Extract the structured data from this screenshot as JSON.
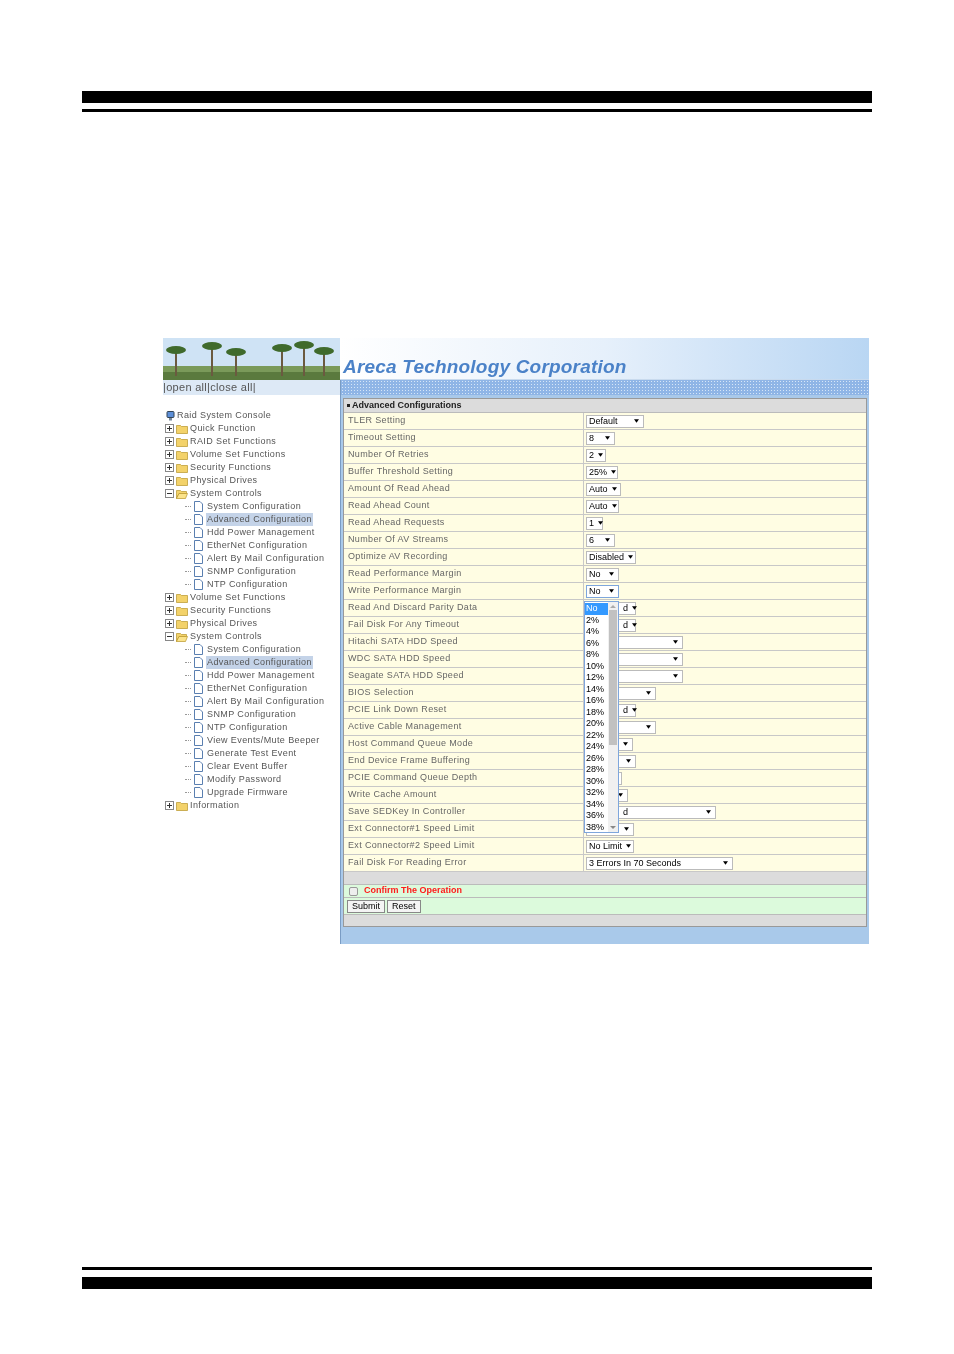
{
  "header": {
    "title": "Areca Technology Corporation"
  },
  "sidebar": {
    "toggle": "|open all|close all|",
    "tree": {
      "label": "Raid System Console",
      "children": [
        {
          "label": "Quick Function",
          "expanded": false
        },
        {
          "label": "RAID Set Functions",
          "expanded": false
        },
        {
          "label": "Volume Set Functions",
          "expanded": false
        },
        {
          "label": "Security Functions",
          "expanded": false
        },
        {
          "label": "Physical Drives",
          "expanded": false
        },
        {
          "label": "System Controls",
          "expanded": true,
          "children": [
            {
              "label": "System Configuration",
              "selected": false
            },
            {
              "label": "Advanced Configuration",
              "selected": true
            },
            {
              "label": "Hdd Power Management",
              "selected": false
            },
            {
              "label": "EtherNet Configuration",
              "selected": false
            },
            {
              "label": "Alert By Mail Configuration",
              "selected": false
            },
            {
              "label": "SNMP Configuration",
              "selected": false
            },
            {
              "label": "NTP Configuration",
              "selected": false
            }
          ]
        },
        {
          "label": "Volume Set Functions",
          "expanded": false
        },
        {
          "label": "Security Functions",
          "expanded": false
        },
        {
          "label": "Physical Drives",
          "expanded": false
        },
        {
          "label": "System Controls",
          "expanded": true,
          "children": [
            {
              "label": "System Configuration",
              "selected": false
            },
            {
              "label": "Advanced Configuration",
              "selected": true
            },
            {
              "label": "Hdd Power Management",
              "selected": false
            },
            {
              "label": "EtherNet Configuration",
              "selected": false
            },
            {
              "label": "Alert By Mail Configuration",
              "selected": false
            },
            {
              "label": "SNMP Configuration",
              "selected": false
            },
            {
              "label": "NTP Configuration",
              "selected": false
            },
            {
              "label": "View Events/Mute Beeper",
              "selected": false
            },
            {
              "label": "Generate Test Event",
              "selected": false
            },
            {
              "label": "Clear Event Buffer",
              "selected": false
            },
            {
              "label": "Modify Password",
              "selected": false
            },
            {
              "label": "Upgrade Firmware",
              "selected": false
            }
          ]
        },
        {
          "label": "Information",
          "expanded": false
        }
      ]
    }
  },
  "form": {
    "title": "Advanced Configurations",
    "rows": [
      {
        "label": "TLER Setting",
        "value": "Default",
        "open": false
      },
      {
        "label": "Timeout Setting",
        "value": "8",
        "open": false
      },
      {
        "label": "Number Of Retries",
        "value": "2",
        "open": false
      },
      {
        "label": "Buffer Threshold Setting",
        "value": "25%",
        "open": false
      },
      {
        "label": "Amount Of Read Ahead",
        "value": "Auto",
        "open": false
      },
      {
        "label": "Read Ahead Count",
        "value": "Auto",
        "open": false
      },
      {
        "label": "Read Ahead Requests",
        "value": "1",
        "open": false
      },
      {
        "label": "Number Of AV Streams",
        "value": "6",
        "open": false
      },
      {
        "label": "Optimize AV Recording",
        "value": "Disabled",
        "open": false
      },
      {
        "label": "Read Performance Margin",
        "value": "No",
        "open": false
      },
      {
        "label": "Write Performance Margin",
        "value": "No",
        "open": true
      },
      {
        "label": "Read And Discard Parity Data",
        "value": "d",
        "open": false
      },
      {
        "label": "Fail Disk For Any Timeout",
        "value": "d",
        "open": false
      },
      {
        "label": "Hitachi SATA HDD Speed",
        "open": false
      },
      {
        "label": "WDC SATA HDD Speed",
        "open": false
      },
      {
        "label": "Seagate SATA HDD Speed",
        "open": false
      },
      {
        "label": "BIOS Selection",
        "open": false
      },
      {
        "label": "PCIE Link Down Reset",
        "value": "d",
        "open": false
      },
      {
        "label": "Active Cable Management",
        "open": false
      },
      {
        "label": "Host Command Queue Mode",
        "open": false
      },
      {
        "label": "End Device Frame Buffering",
        "open": false
      },
      {
        "label": "PCIE Command Queue Depth",
        "open": false
      },
      {
        "label": "Write Cache Amount",
        "open": false
      },
      {
        "label": "Save SEDKey In Controller",
        "value": "d",
        "open": false
      },
      {
        "label": "Ext Connector#1 Speed Limit",
        "open": false
      },
      {
        "label": "Ext Connector#2 Speed Limit",
        "value": "No Limit",
        "open": false
      },
      {
        "label": "Fail Disk For Reading Error",
        "value": "3 Errors In 70 Seconds",
        "open": false
      }
    ],
    "dropdown": [
      {
        "label": "No",
        "selected": true
      },
      {
        "label": "2%",
        "selected": false
      },
      {
        "label": "4%",
        "selected": false
      },
      {
        "label": "6%",
        "selected": false
      },
      {
        "label": "8%",
        "selected": false
      },
      {
        "label": "10%",
        "selected": false
      },
      {
        "label": "12%",
        "selected": false
      },
      {
        "label": "14%",
        "selected": false
      },
      {
        "label": "16%",
        "selected": false
      },
      {
        "label": "18%",
        "selected": false
      },
      {
        "label": "20%",
        "selected": false
      },
      {
        "label": "22%",
        "selected": false
      },
      {
        "label": "24%",
        "selected": false
      },
      {
        "label": "26%",
        "selected": false
      },
      {
        "label": "28%",
        "selected": false
      },
      {
        "label": "30%",
        "selected": false
      },
      {
        "label": "32%",
        "selected": false
      },
      {
        "label": "34%",
        "selected": false
      },
      {
        "label": "36%",
        "selected": false
      },
      {
        "label": "38%",
        "selected": false
      }
    ],
    "confirm": {
      "label": "Confirm The Operation",
      "checked": false
    },
    "buttons": [
      "Submit",
      "Reset"
    ]
  }
}
